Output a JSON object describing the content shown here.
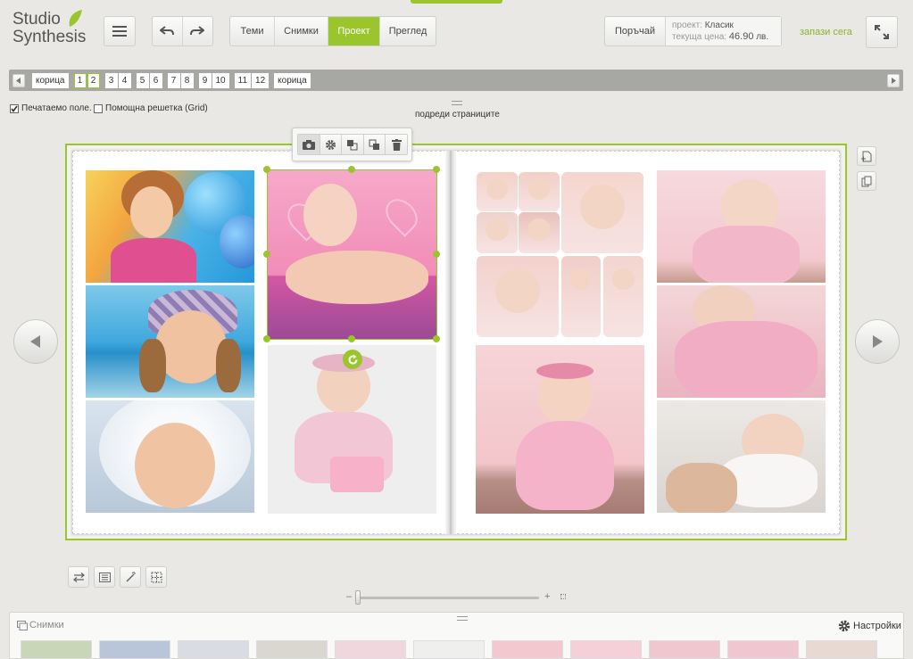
{
  "logo": {
    "line1": "Studio",
    "line2": "Synthesis"
  },
  "icons": {
    "menu": "hamburger-icon",
    "undo": "undo-arrow-icon",
    "redo": "redo-arrow-icon",
    "fullscreen": "expand-icon",
    "camera": "camera-icon",
    "gear": "gear-icon",
    "trash": "trash-icon"
  },
  "nav_tabs": [
    {
      "label": "Теми",
      "active": false
    },
    {
      "label": "Снимки",
      "active": false
    },
    {
      "label": "Проект",
      "active": true
    },
    {
      "label": "Преглед",
      "active": false
    }
  ],
  "order": {
    "button_label": "Поръчай",
    "project_label": "проект:",
    "project_value": "Класик",
    "price_label": "текуща цена:",
    "price_value": "46.90",
    "price_unit": "лв."
  },
  "save_now": "запази сега",
  "pages": {
    "items": [
      "корица",
      "1",
      "2",
      "3",
      "4",
      "5",
      "6",
      "7",
      "8",
      "9",
      "10",
      "11",
      "12",
      "корица"
    ],
    "selected": [
      "1",
      "2"
    ]
  },
  "options": {
    "printable_label": "Печатаемо поле.",
    "printable_checked": true,
    "grid_label": "Помощна решетка (Grid)",
    "grid_checked": false,
    "arrange_label": "подреди страниците"
  },
  "zoom": {
    "minus": "–",
    "plus": "+",
    "level": 0
  },
  "photos_panel": {
    "title": "Снимки",
    "settings_label": "Настройки"
  },
  "colors": {
    "accent": "#9ac52d",
    "background": "#e9e8e4"
  }
}
